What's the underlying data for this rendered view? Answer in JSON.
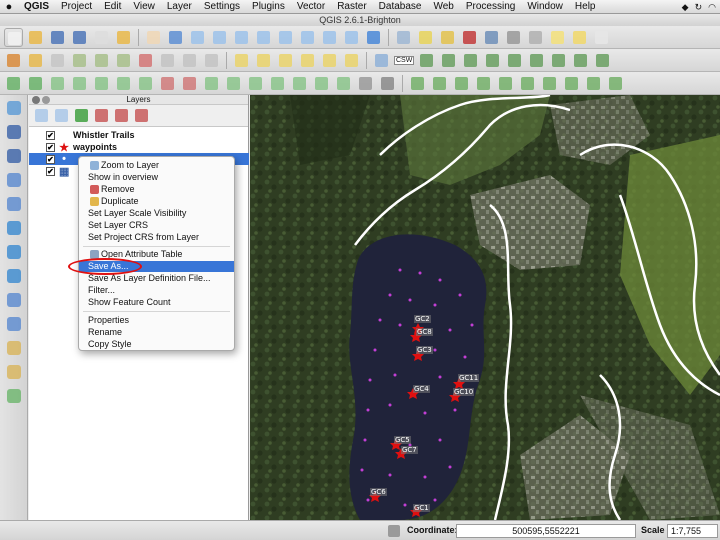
{
  "menubar": {
    "apple": "",
    "items": [
      "QGIS",
      "Project",
      "Edit",
      "View",
      "Layer",
      "Settings",
      "Plugins",
      "Vector",
      "Raster",
      "Database",
      "Web",
      "Processing",
      "Window",
      "Help"
    ]
  },
  "window": {
    "title": "QGIS 2.6.1-Brighton"
  },
  "layers_panel": {
    "title": "Layers",
    "layers": [
      {
        "name": "Whistler Trails",
        "checked": true,
        "icon": "line-icon"
      },
      {
        "name": "waypoints",
        "checked": true,
        "icon": "red-star-icon"
      },
      {
        "name": "",
        "checked": true,
        "icon": "point-icon",
        "selected": true
      },
      {
        "name": "",
        "checked": true,
        "icon": "raster-icon"
      }
    ]
  },
  "context_menu": {
    "items": [
      {
        "label": "Zoom to Layer",
        "icon": "zoom-icon"
      },
      {
        "label": "Show in overview"
      },
      {
        "label": "Remove",
        "icon": "remove-icon"
      },
      {
        "label": "Duplicate",
        "icon": "duplicate-icon"
      },
      {
        "label": "Set Layer Scale Visibility"
      },
      {
        "label": "Set Layer CRS"
      },
      {
        "label": "Set Project CRS from Layer"
      },
      {
        "label": "Open Attribute Table",
        "icon": "table-icon"
      },
      {
        "label": "Save As...",
        "highlighted": true
      },
      {
        "label": "Save As Layer Definition File..."
      },
      {
        "label": "Filter..."
      },
      {
        "label": "Show Feature Count"
      },
      {
        "label": "Properties"
      },
      {
        "label": "Rename"
      },
      {
        "label": "Copy Style"
      }
    ]
  },
  "map": {
    "waypoint_labels": [
      "GC2",
      "GC8",
      "GC3",
      "GC11",
      "GC4",
      "GC10",
      "GC5",
      "GC7",
      "GC6",
      "GC1"
    ]
  },
  "toolbar": {
    "csw_label": "CSW"
  },
  "statusbar": {
    "coordinate_label": "Coordinate:",
    "coordinate_value": "500595,5552221",
    "scale_label": "Scale",
    "scale_value": "1:7,755"
  },
  "colors": {
    "selection": "#3875d7",
    "annotation_oval": "#e01010",
    "waypoint_marker": "#e01010",
    "trail": "#ffffff",
    "lake": "#20233a"
  }
}
